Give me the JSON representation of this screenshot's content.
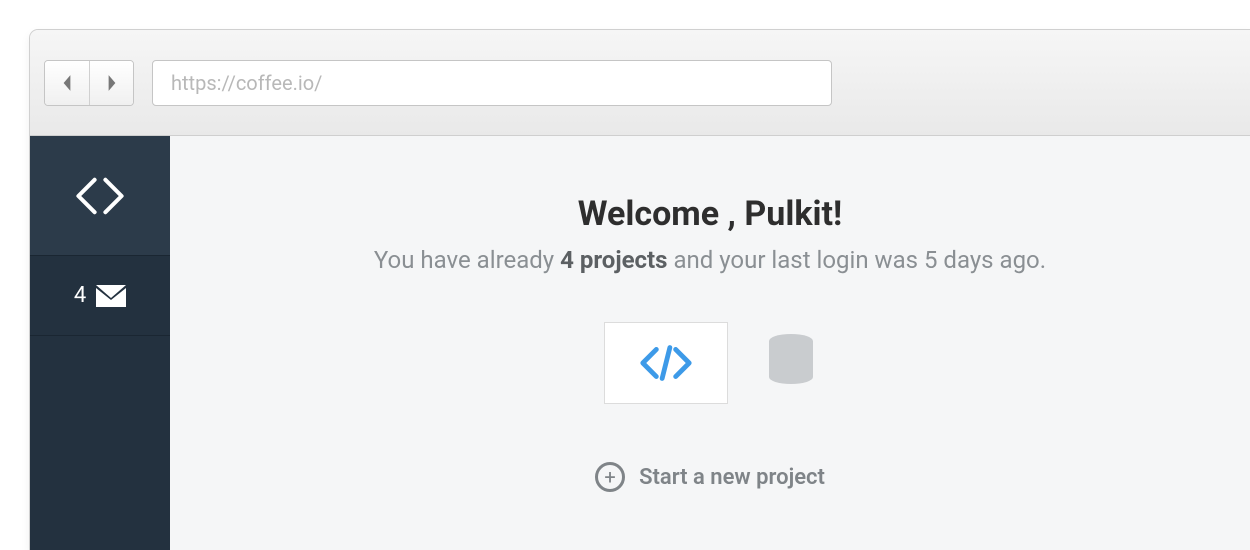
{
  "browser": {
    "url": "https://coffee.io/"
  },
  "sidebar": {
    "mail_count": "4"
  },
  "main": {
    "welcome_prefix": "Welcome , ",
    "welcome_name": "Pulkit!",
    "sub_prefix": "You have already ",
    "sub_bold": "4 projects",
    "sub_suffix": " and your last login was 5 days ago.",
    "start_label": "Start a new project"
  }
}
